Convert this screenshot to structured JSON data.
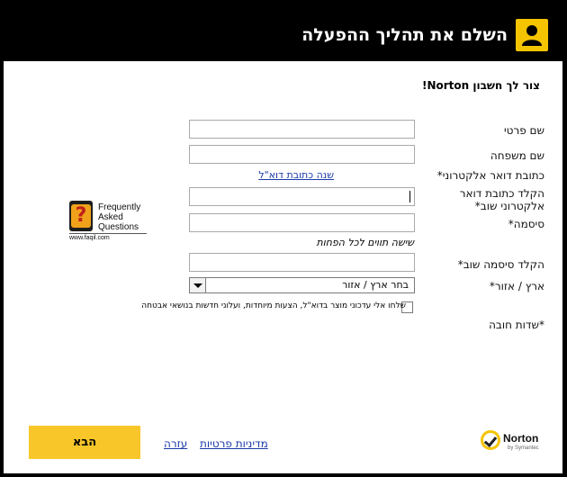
{
  "header": {
    "title": "השלם את תהליך ההפעלה",
    "icon": "user-icon",
    "badge_color": "#f5c400"
  },
  "form": {
    "heading": "צור לך חשבון Norton!",
    "first_name_label": "שם פרטי",
    "last_name_label": "שם משפחה",
    "email_label": "כתובת דואר אלקטרוני*",
    "change_email_link": "שנה כתובת דוא\"ל",
    "confirm_email_label": "הקלד כתובת דואר אלקטרוני שוב*",
    "password_label": "סיסמה*",
    "password_hint": "שישה תווים לכל הפחות",
    "confirm_password_label": "הקלד סיסמה שוב*",
    "country_label": "ארץ / אזור*",
    "country_value": "בחר ארץ / אזור",
    "newsletter_label": "שלחו אלי עדכוני מוצר בדוא\"ל, הצעות מיוחדות, ועלוני חדשות בנושאי אבטחה",
    "required_note": "*שדות חובה"
  },
  "faq": {
    "mark": "?",
    "line1": "Frequently",
    "line2": "Asked",
    "line3": "Questions",
    "url": "www.faqil.com"
  },
  "footer": {
    "next_label": "הבא",
    "help_link": "עזרה",
    "privacy_link": "מדיניות פרטיות",
    "brand": "Norton",
    "brand_sub": "by Symantec",
    "accent_color": "#f9c62a"
  }
}
